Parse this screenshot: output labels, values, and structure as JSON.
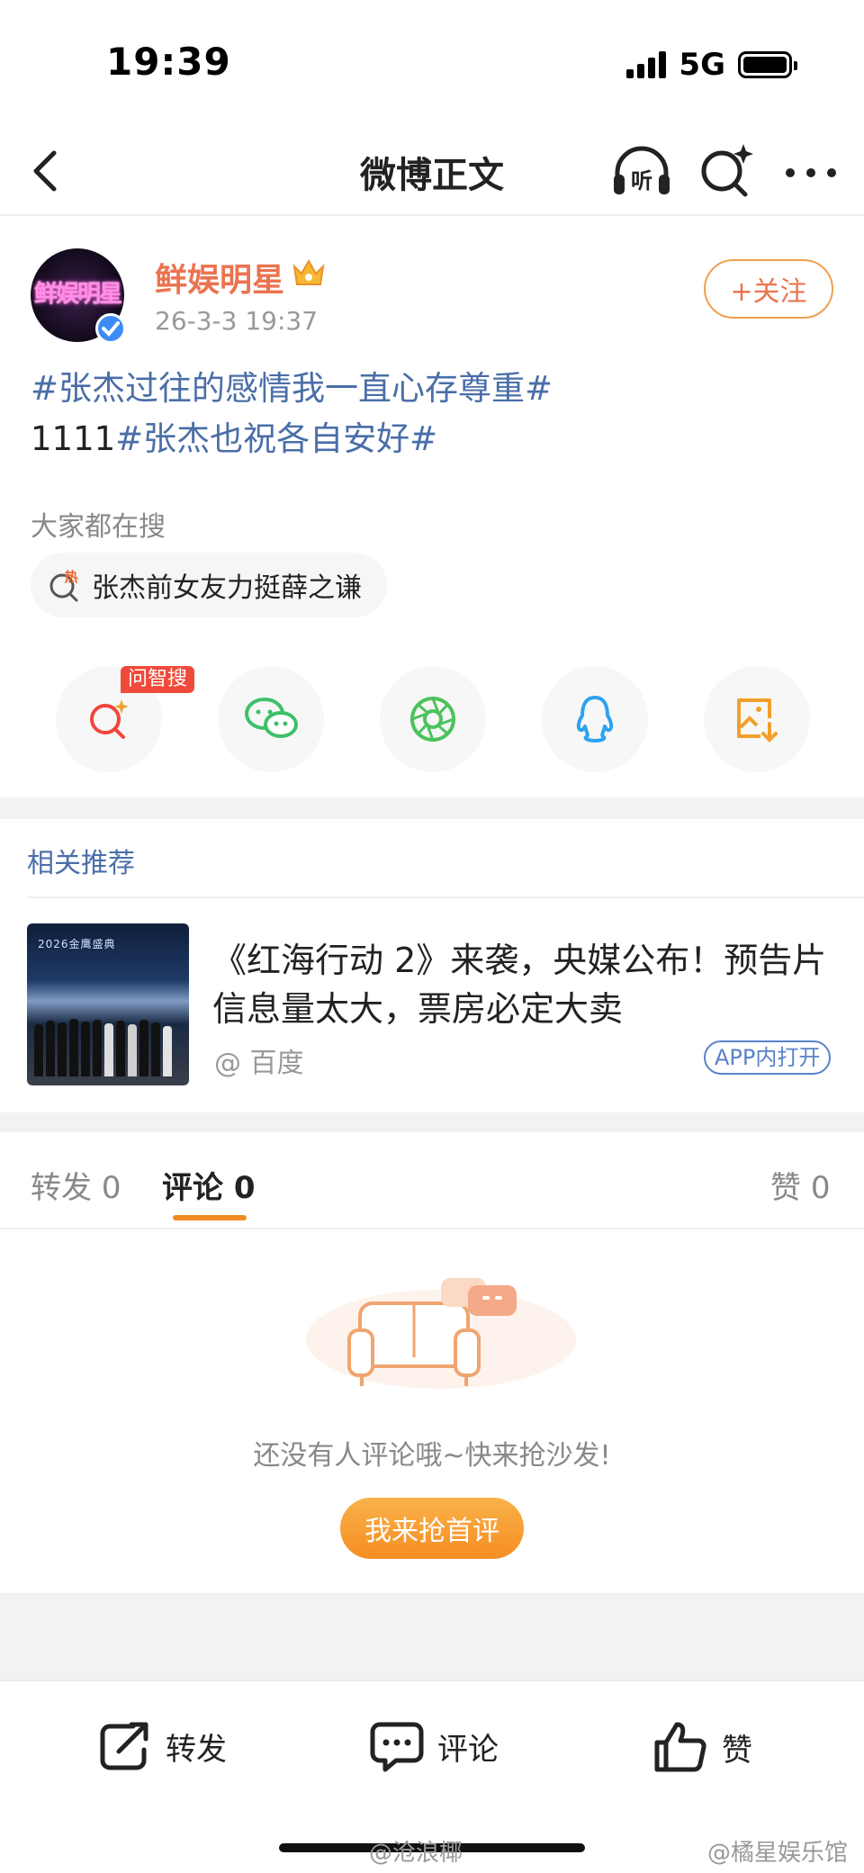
{
  "status_bar": {
    "time": "19:39",
    "network": "5G"
  },
  "nav": {
    "title": "微博正文"
  },
  "post": {
    "avatar_text": "鲜娱明星",
    "username": "鲜娱明星",
    "time": "26-3-3 19:37",
    "follow_label": "+关注",
    "text_line1_tag": "#张杰过往的感情我一直心存尊重#",
    "text_line2_prefix": "1111",
    "text_line2_tag": "#张杰也祝各自安好#"
  },
  "trending": {
    "label": "大家都在搜",
    "hot_badge": "热",
    "item": "张杰前女友力挺薛之谦"
  },
  "share": {
    "ai_badge": "问智搜"
  },
  "recommend": {
    "title": "相关推荐",
    "thumb_text": "2026金鹰盛典",
    "headline": "《红海行动 2》来袭，央媒公布！预告片信息量太大，票房必定大卖",
    "source": "@ 百度",
    "app_open": "APP内打开"
  },
  "tabs": {
    "repost_label": "转发",
    "repost_count": "0",
    "comment_label": "评论",
    "comment_count": "0",
    "like_label": "赞",
    "like_count": "0"
  },
  "empty": {
    "text": "还没有人评论哦~快来抢沙发!",
    "button": "我来抢首评"
  },
  "bottom_bar": {
    "repost": "转发",
    "comment": "评论",
    "like": "赞"
  },
  "watermarks": {
    "left": "@沧浪椰",
    "right": "@橘星娱乐馆"
  },
  "colors": {
    "accent": "#eb7350",
    "tag": "#4a6ea8",
    "cta": "#f58d22"
  }
}
